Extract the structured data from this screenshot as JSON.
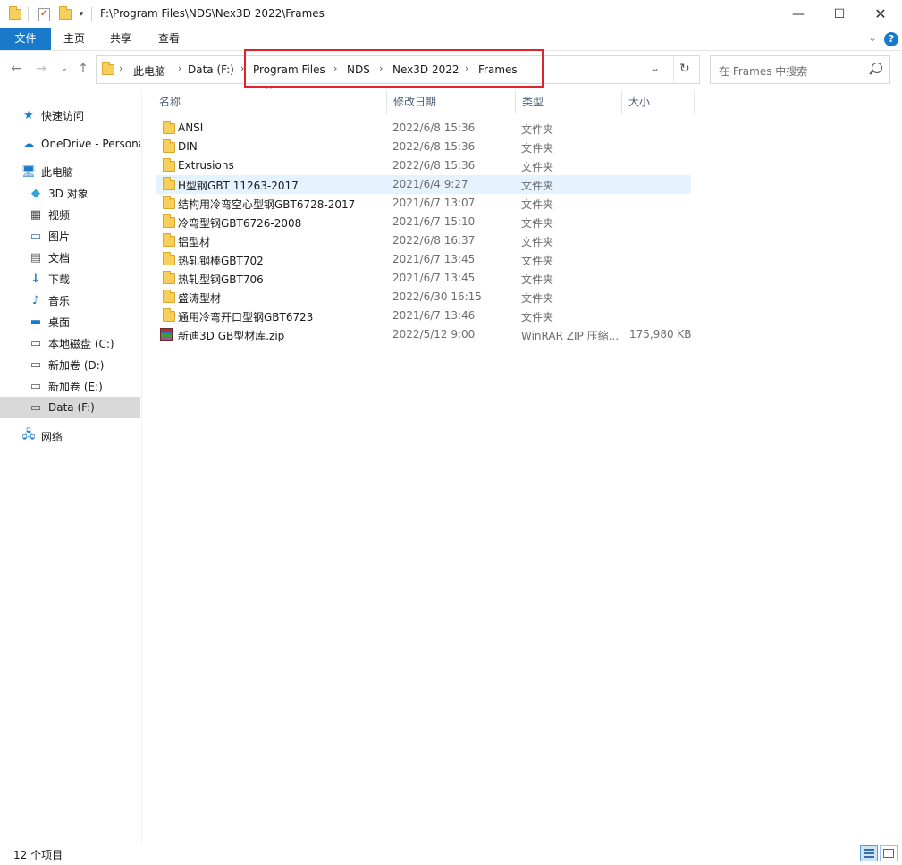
{
  "titlebar": {
    "path": "F:\\Program Files\\NDS\\Nex3D 2022\\Frames",
    "minimize_icon": "minimize-icon",
    "maximize_icon": "maximize-icon",
    "close_icon": "close-icon"
  },
  "ribbon": {
    "tabs": [
      "文件",
      "主页",
      "共享",
      "查看"
    ]
  },
  "address": {
    "crumbs": [
      "此电脑",
      "Data (F:)",
      "Program Files",
      "NDS",
      "Nex3D 2022",
      "Frames"
    ]
  },
  "search": {
    "placeholder": "在 Frames 中搜索"
  },
  "nav": {
    "items": [
      {
        "label": "快速访问",
        "icon": "star-icon"
      },
      {
        "label": "OneDrive - Persona",
        "icon": "cloud-icon"
      },
      {
        "label": "此电脑",
        "icon": "computer-icon"
      },
      {
        "label": "3D 对象",
        "icon": "cube-icon"
      },
      {
        "label": "视频",
        "icon": "video-icon"
      },
      {
        "label": "图片",
        "icon": "picture-icon"
      },
      {
        "label": "文档",
        "icon": "document-icon"
      },
      {
        "label": "下载",
        "icon": "download-icon"
      },
      {
        "label": "音乐",
        "icon": "music-icon"
      },
      {
        "label": "桌面",
        "icon": "desktop-icon"
      },
      {
        "label": "本地磁盘 (C:)",
        "icon": "drive-icon"
      },
      {
        "label": "新加卷 (D:)",
        "icon": "drive-icon"
      },
      {
        "label": "新加卷 (E:)",
        "icon": "drive-icon"
      },
      {
        "label": "Data (F:)",
        "icon": "drive-icon"
      },
      {
        "label": "网络",
        "icon": "network-icon"
      }
    ]
  },
  "columns": {
    "name": "名称",
    "date": "修改日期",
    "type": "类型",
    "size": "大小"
  },
  "files": [
    {
      "name": "ANSI",
      "date": "2022/6/8 15:36",
      "type": "文件夹",
      "size": ""
    },
    {
      "name": "DIN",
      "date": "2022/6/8 15:36",
      "type": "文件夹",
      "size": ""
    },
    {
      "name": "Extrusions",
      "date": "2022/6/8 15:36",
      "type": "文件夹",
      "size": ""
    },
    {
      "name": "H型钢GBT 11263-2017",
      "date": "2021/6/4 9:27",
      "type": "文件夹",
      "size": ""
    },
    {
      "name": "结构用冷弯空心型钢GBT6728-2017",
      "date": "2021/6/7 13:07",
      "type": "文件夹",
      "size": ""
    },
    {
      "name": "冷弯型钢GBT6726-2008",
      "date": "2021/6/7 15:10",
      "type": "文件夹",
      "size": ""
    },
    {
      "name": "铝型材",
      "date": "2022/6/8 16:37",
      "type": "文件夹",
      "size": ""
    },
    {
      "name": "热轧钢棒GBT702",
      "date": "2021/6/7 13:45",
      "type": "文件夹",
      "size": ""
    },
    {
      "name": "热轧型钢GBT706",
      "date": "2021/6/7 13:45",
      "type": "文件夹",
      "size": ""
    },
    {
      "name": "盛涛型材",
      "date": "2022/6/30 16:15",
      "type": "文件夹",
      "size": ""
    },
    {
      "name": "通用冷弯开口型钢GBT6723",
      "date": "2021/6/7 13:46",
      "type": "文件夹",
      "size": ""
    },
    {
      "name": "新迪3D GB型材库.zip",
      "date": "2022/5/12 9:00",
      "type": "WinRAR ZIP 压缩...",
      "size": "175,980 KB"
    }
  ],
  "status": {
    "count": "12 个项目"
  },
  "colors": {
    "accent": "#1979ca",
    "highlight_box": "#e0232a",
    "row_hover": "#e5f3ff",
    "selected_nav": "#d9d9d9"
  }
}
